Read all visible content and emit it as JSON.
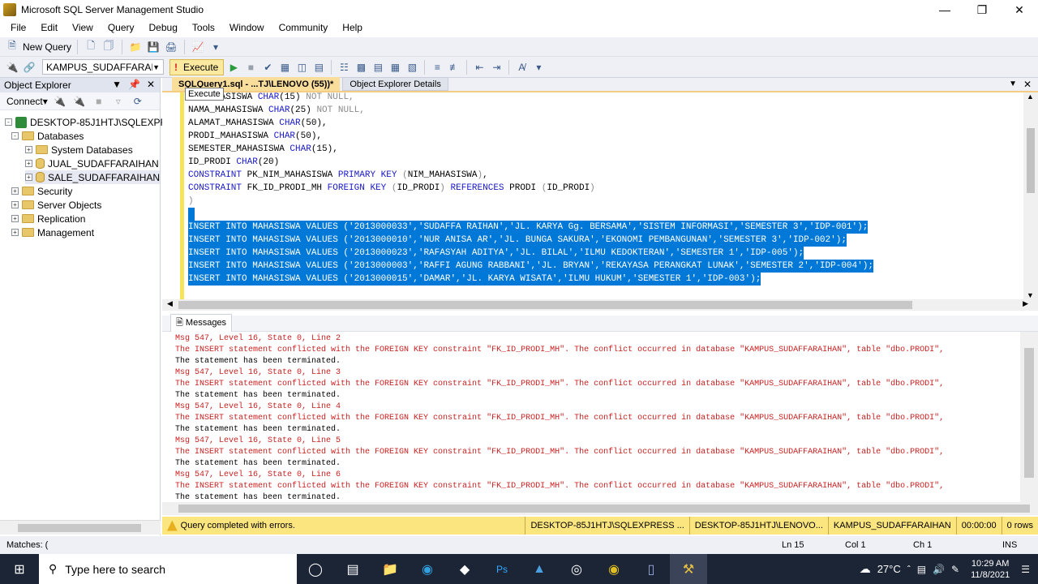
{
  "window": {
    "title": "Microsoft SQL Server Management Studio"
  },
  "menu": [
    "File",
    "Edit",
    "View",
    "Query",
    "Debug",
    "Tools",
    "Window",
    "Community",
    "Help"
  ],
  "toolbar": {
    "new_query": "New Query",
    "database": "KAMPUS_SUDAFFARAIHAN",
    "execute": "Execute",
    "tooltip": "Execute"
  },
  "object_explorer": {
    "title": "Object Explorer",
    "connect": "Connect",
    "nodes": [
      "DESKTOP-85J1HTJ\\SQLEXPRESS (S",
      "Databases",
      "System Databases",
      "JUAL_SUDAFFARAIHAN",
      "SALE_SUDAFFARAIHAN",
      "Security",
      "Server Objects",
      "Replication",
      "Management"
    ]
  },
  "tabs": {
    "active": "SQLQuery1.sql - ...TJ\\LENOVO (55))*",
    "second": "Object Explorer Details"
  },
  "editor": {
    "lines": [
      {
        "t": "ID_MAHASISWA ",
        "k": "CHAR",
        "r": "(15) ",
        "g": "NOT NULL,"
      },
      {
        "t": "NAMA_MAHASISWA ",
        "k": "CHAR",
        "r": "(25) ",
        "g": "NOT NULL,"
      },
      {
        "t": "ALAMAT_MAHASISWA ",
        "k": "CHAR",
        "r": "(50),",
        "g": ""
      },
      {
        "t": "PRODI_MAHASISWA ",
        "k": "CHAR",
        "r": "(50),",
        "g": ""
      },
      {
        "t": "SEMESTER_MAHASISWA ",
        "k": "CHAR",
        "r": "(15),",
        "g": ""
      },
      {
        "t": "ID_PRODI ",
        "k": "CHAR",
        "r": "(20)",
        "g": ""
      }
    ],
    "constraint1": "CONSTRAINT PK_NIM_MAHASISWA PRIMARY KEY (NIM_MAHASISWA),",
    "constraint2": "CONSTRAINT FK_ID_PRODI_MH FOREIGN KEY (ID_PRODI) REFERENCES PRODI (ID_PRODI)",
    "close_paren": ")",
    "inserts": [
      "INSERT INTO MAHASISWA VALUES ('2013000033','SUDAFFA RAIHAN','JL. KARYA Gg. BERSAMA','SISTEM INFORMASI','SEMESTER 3','IDP-001');",
      "INSERT INTO MAHASISWA VALUES ('2013000010','NUR ANISA AR','JL. BUNGA SAKURA','EKONOMI PEMBANGUNAN','SEMESTER 3','IDP-002');",
      "INSERT INTO MAHASISWA VALUES ('2013000023','RAFASYAH ADITYA','JL. BILAL','ILMU KEDOKTERAN','SEMESTER 1','IDP-005');",
      "INSERT INTO MAHASISWA VALUES ('2013000003','RAFFI AGUNG RABBANI','JL. BRYAN','REKAYASA PERANGKAT LUNAK','SEMESTER 2','IDP-004');",
      "INSERT INTO MAHASISWA VALUES ('2013000015','DAMAR','JL. KARYA WISATA','ILMU HUKUM','SEMESTER 1','IDP-003');"
    ]
  },
  "messages": {
    "tab": "Messages",
    "lines": [
      {
        "c": "red",
        "t": "Msg 547, Level 16, State 0, Line 2"
      },
      {
        "c": "red",
        "t": "The INSERT statement conflicted with the FOREIGN KEY constraint \"FK_ID_PRODI_MH\". The conflict occurred in database \"KAMPUS_SUDAFFARAIHAN\", table \"dbo.PRODI\","
      },
      {
        "c": "black",
        "t": "The statement has been terminated."
      },
      {
        "c": "red",
        "t": "Msg 547, Level 16, State 0, Line 3"
      },
      {
        "c": "red",
        "t": "The INSERT statement conflicted with the FOREIGN KEY constraint \"FK_ID_PRODI_MH\". The conflict occurred in database \"KAMPUS_SUDAFFARAIHAN\", table \"dbo.PRODI\","
      },
      {
        "c": "black",
        "t": "The statement has been terminated."
      },
      {
        "c": "red",
        "t": "Msg 547, Level 16, State 0, Line 4"
      },
      {
        "c": "red",
        "t": "The INSERT statement conflicted with the FOREIGN KEY constraint \"FK_ID_PRODI_MH\". The conflict occurred in database \"KAMPUS_SUDAFFARAIHAN\", table \"dbo.PRODI\","
      },
      {
        "c": "black",
        "t": "The statement has been terminated."
      },
      {
        "c": "red",
        "t": "Msg 547, Level 16, State 0, Line 5"
      },
      {
        "c": "red",
        "t": "The INSERT statement conflicted with the FOREIGN KEY constraint \"FK_ID_PRODI_MH\". The conflict occurred in database \"KAMPUS_SUDAFFARAIHAN\", table \"dbo.PRODI\","
      },
      {
        "c": "black",
        "t": "The statement has been terminated."
      },
      {
        "c": "red",
        "t": "Msg 547, Level 16, State 0, Line 6"
      },
      {
        "c": "red",
        "t": "The INSERT statement conflicted with the FOREIGN KEY constraint \"FK_ID_PRODI_MH\". The conflict occurred in database \"KAMPUS_SUDAFFARAIHAN\", table \"dbo.PRODI\","
      },
      {
        "c": "black",
        "t": "The statement has been terminated."
      }
    ]
  },
  "status": {
    "message": "Query completed with errors.",
    "server": "DESKTOP-85J1HTJ\\SQLEXPRESS ...",
    "user": "DESKTOP-85J1HTJ\\LENOVO...",
    "database": "KAMPUS_SUDAFFARAIHAN",
    "time": "00:00:00",
    "rows": "0 rows"
  },
  "bottombar": {
    "matches": "Matches: (",
    "ln": "Ln 15",
    "col": "Col 1",
    "ch": "Ch 1",
    "ins": "INS"
  },
  "taskbar": {
    "search": "Type here to search",
    "temp": "27°C",
    "time": "10:29 AM",
    "date": "11/8/2021"
  },
  "colors": {
    "selection": "#0078d7",
    "error": "#c82020",
    "keyword": "#1919c8",
    "status": "#fbe57f"
  }
}
